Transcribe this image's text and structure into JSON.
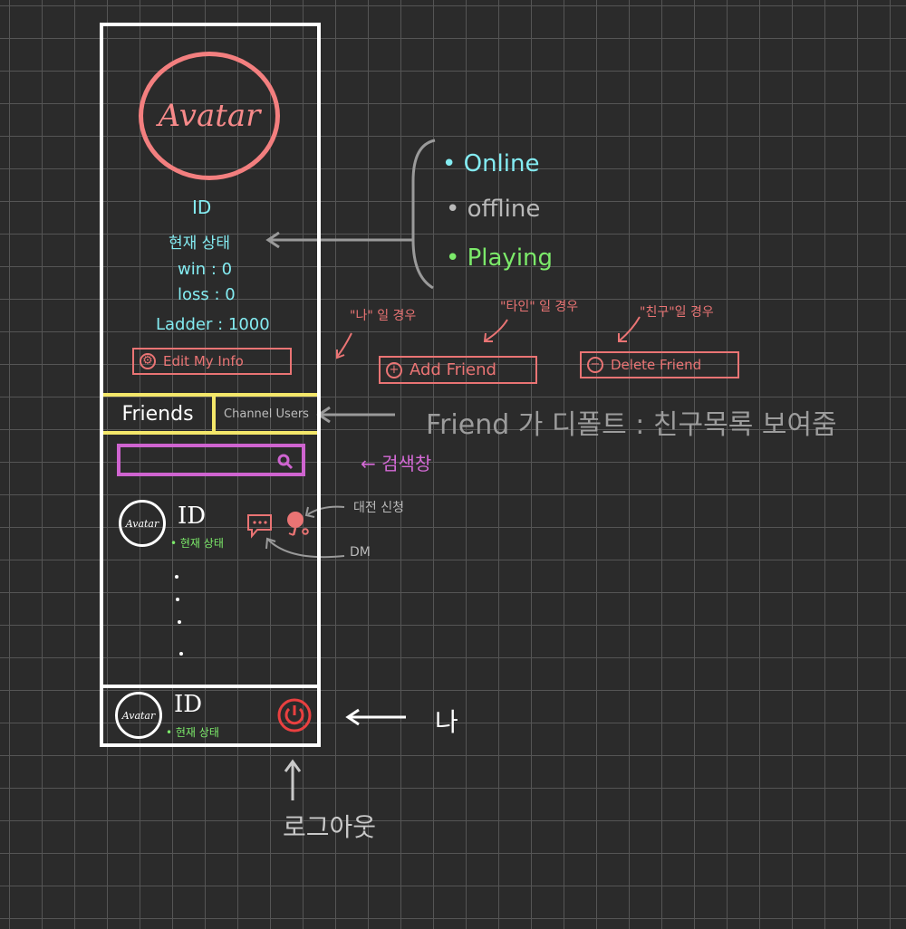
{
  "profile": {
    "avatar_label": "Avatar",
    "id": "ID",
    "status": "현재 상태",
    "win": "win :  0",
    "loss": "loss :  0",
    "ladder": "Ladder : 1000"
  },
  "status_options": {
    "online": "• Online",
    "offline": "• offline",
    "playing": "• Playing"
  },
  "buttons": {
    "edit_info": "Edit  My Info",
    "add_friend": "Add   Friend",
    "delete_friend": "Delete  Friend"
  },
  "cases": {
    "me": "\"나\" 일 경우",
    "other": "\"타인\" 일 경우",
    "friend": "\"친구\"일 경우"
  },
  "tabs": {
    "friends": "Friends",
    "channel_users": "Channel Users"
  },
  "friend_row": {
    "avatar_label": "Avatar",
    "id": "ID",
    "status": "• 현재 상태"
  },
  "me_row": {
    "avatar_label": "Avatar",
    "id": "ID",
    "status": "• 현재 상태"
  },
  "notes": {
    "default_tab": "Friend 가 디폴트 : 친구목록 보여줌",
    "search": "← 검색창",
    "battle": "대전 신청",
    "dm": "DM",
    "me": "나",
    "logout": "로그아웃"
  },
  "colors": {
    "background": "#2b2b2b",
    "panel_border": "#ffffff",
    "avatar_ring": "#f37f7f",
    "profile_text": "#84ecf2",
    "tab_border": "#f4e76a",
    "search_border": "#cf64d0",
    "button_border": "#ea7474",
    "online": "#84ecf2",
    "offline": "#b9b9b9",
    "playing": "#7cea6a"
  }
}
